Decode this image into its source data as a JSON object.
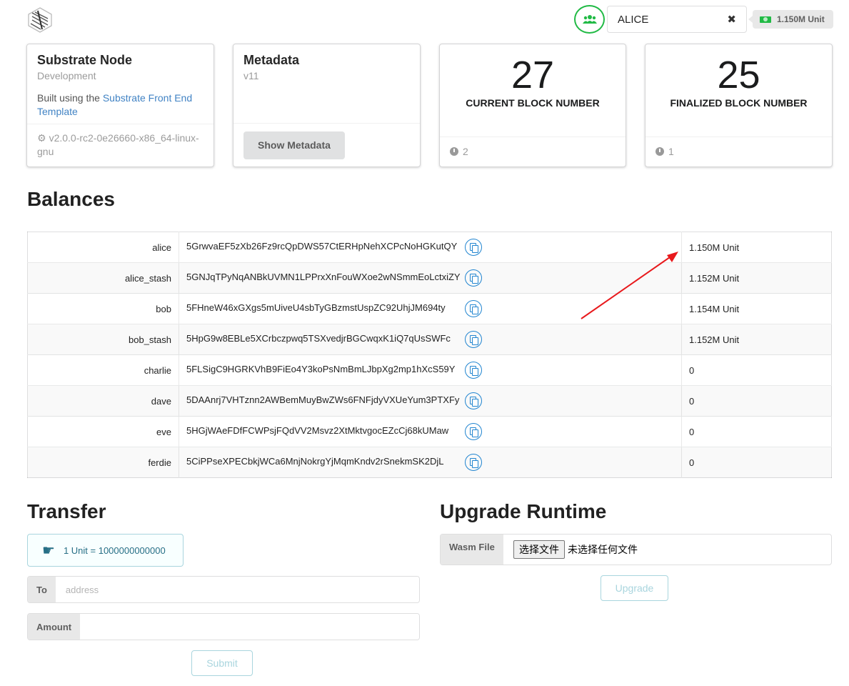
{
  "header": {
    "account_selected": "ALICE",
    "clear_symbol": "✖",
    "balance": "1.150M Unit"
  },
  "cards": {
    "node": {
      "title": "Substrate Node",
      "meta": "Development",
      "desc_prefix": "Built using the ",
      "desc_link": "Substrate Front End Template",
      "version": "v2.0.0-rc2-0e26660-x86_64-linux-gnu"
    },
    "metadata": {
      "title": "Metadata",
      "version": "v11",
      "button": "Show Metadata"
    },
    "current_block": {
      "value": "27",
      "label": "CURRENT BLOCK NUMBER",
      "timer": "2"
    },
    "finalized_block": {
      "value": "25",
      "label": "FINALIZED BLOCK NUMBER",
      "timer": "1"
    }
  },
  "balances": {
    "title": "Balances",
    "rows": [
      {
        "name": "alice",
        "address": "5GrwvaEF5zXb26Fz9rcQpDWS57CtERHpNehXCPcNoHGKutQY",
        "balance": "1.150M Unit"
      },
      {
        "name": "alice_stash",
        "address": "5GNJqTPyNqANBkUVMN1LPPrxXnFouWXoe2wNSmmEoLctxiZY",
        "balance": "1.152M Unit"
      },
      {
        "name": "bob",
        "address": "5FHneW46xGXgs5mUiveU4sbTyGBzmstUspZC92UhjJM694ty",
        "balance": "1.154M Unit"
      },
      {
        "name": "bob_stash",
        "address": "5HpG9w8EBLe5XCrbczpwq5TSXvedjrBGCwqxK1iQ7qUsSWFc",
        "balance": "1.152M Unit"
      },
      {
        "name": "charlie",
        "address": "5FLSigC9HGRKVhB9FiEo4Y3koPsNmBmLJbpXg2mp1hXcS59Y",
        "balance": "0"
      },
      {
        "name": "dave",
        "address": "5DAAnrj7VHTznn2AWBemMuyBwZWs6FNFjdyVXUeYum3PTXFy",
        "balance": "0"
      },
      {
        "name": "eve",
        "address": "5HGjWAeFDfFCWPsjFQdVV2Msvz2XtMktvgocEZcCj68kUMaw",
        "balance": "0"
      },
      {
        "name": "ferdie",
        "address": "5CiPPseXPECbkjWCa6MnjNokrgYjMqmKndv2rSnekmSK2DjL",
        "balance": "0"
      }
    ]
  },
  "transfer": {
    "title": "Transfer",
    "info": "1 Unit = 1000000000000",
    "to_label": "To",
    "to_placeholder": "address",
    "amount_label": "Amount",
    "submit": "Submit"
  },
  "upgrade": {
    "title": "Upgrade Runtime",
    "wasm_label": "Wasm File",
    "choose_file": "选择文件",
    "no_file": "未选择任何文件",
    "button": "Upgrade"
  },
  "colors": {
    "accent_green": "#21ba45",
    "link_blue": "#4183c4",
    "copy_blue": "#2185d0",
    "annotation_red": "#e8191c"
  }
}
